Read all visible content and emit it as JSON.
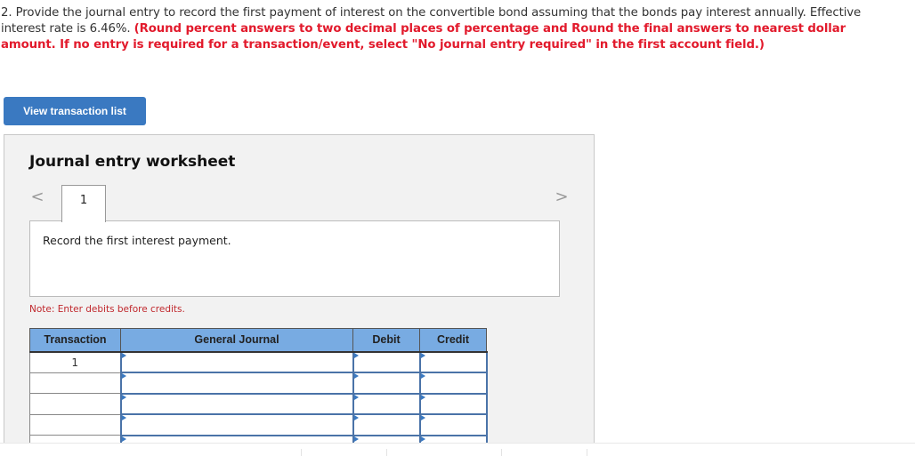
{
  "question": {
    "prefix": "2. Provide the journal entry to record the first payment of interest on the convertible bond assuming that the bonds pay interest annually. Effective interest rate is 6.46%. ",
    "instructions": "(Round percent answers to two decimal places of percentage and Round the final answers to nearest dollar amount. If no entry is required for a transaction/event, select \"No journal entry required\" in the first account field.)"
  },
  "toolbar": {
    "view_transaction_list_label": "View transaction list"
  },
  "worksheet": {
    "title": "Journal entry worksheet",
    "prev_icon": "chevron-left-icon",
    "next_icon": "chevron-right-icon",
    "prev_glyph": "<",
    "next_glyph": ">",
    "tabs": [
      {
        "label": "1"
      }
    ],
    "description": "Record the first interest payment.",
    "note": "Note: Enter debits before credits."
  },
  "journal_table": {
    "headers": {
      "transaction": "Transaction",
      "general_journal": "General Journal",
      "debit": "Debit",
      "credit": "Credit"
    },
    "rows": [
      {
        "transaction": "1",
        "account": "",
        "debit": "",
        "credit": ""
      },
      {
        "transaction": "",
        "account": "",
        "debit": "",
        "credit": ""
      },
      {
        "transaction": "",
        "account": "",
        "debit": "",
        "credit": ""
      },
      {
        "transaction": "",
        "account": "",
        "debit": "",
        "credit": ""
      },
      {
        "transaction": "",
        "account": "",
        "debit": "",
        "credit": ""
      }
    ]
  },
  "colors": {
    "accent_button": "#3a79c1",
    "instruction_red": "#e21a2c",
    "header_blue": "#78abe2",
    "note_red": "#c0282d"
  }
}
